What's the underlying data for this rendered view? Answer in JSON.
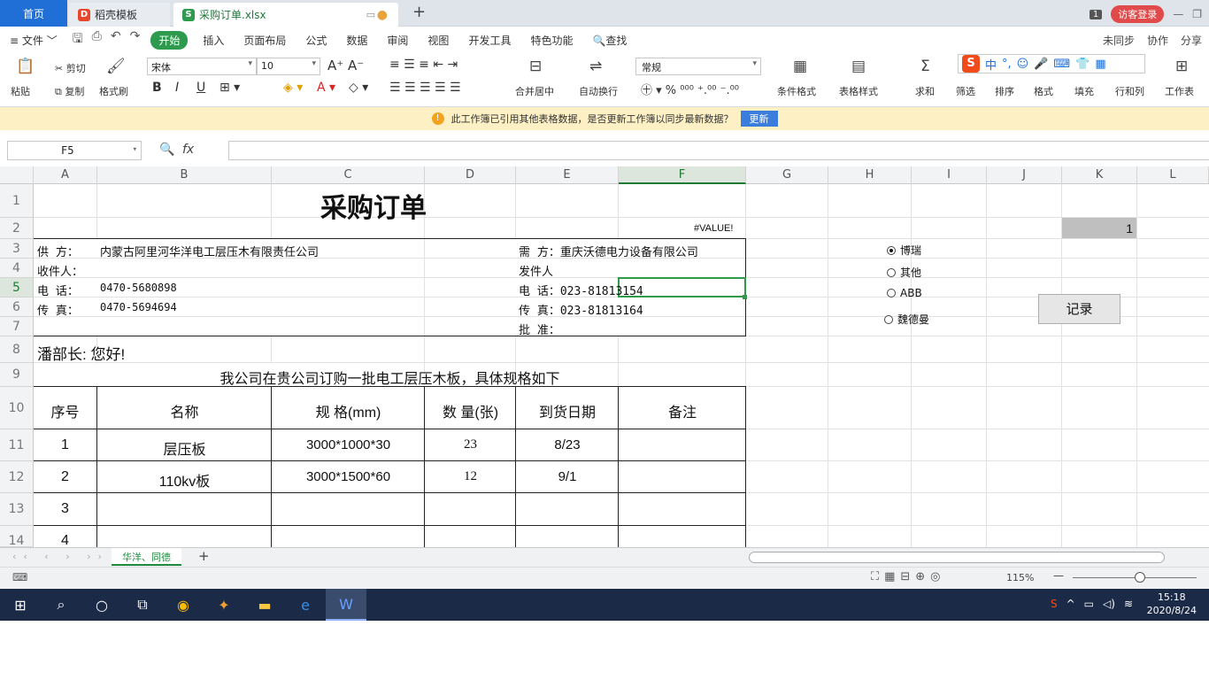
{
  "titlebar": {
    "home_tab": "首页",
    "tpl_tab": "稻壳模板",
    "file_tab": "采购订单.xlsx",
    "page_count": "1",
    "login": "访客登录"
  },
  "menu": {
    "file": "文件",
    "items": [
      "开始",
      "插入",
      "页面布局",
      "公式",
      "数据",
      "审阅",
      "视图",
      "开发工具",
      "特色功能"
    ],
    "search": "查找",
    "right": [
      "未同步",
      "协作",
      "分享"
    ]
  },
  "ribbon": {
    "paste": "粘贴",
    "cut": "剪切",
    "copy": "复制",
    "format_painter": "格式刷",
    "font": "宋体",
    "size": "10",
    "merge": "合并居中",
    "wrap": "自动换行",
    "number_format": "常规",
    "cond_format": "条件格式",
    "table_style": "表格样式",
    "sum": "求和",
    "filter": "筛选",
    "sort": "排序",
    "format": "格式",
    "fill": "填充",
    "row_col": "行和列",
    "worksheet": "工作表"
  },
  "notice": {
    "text": "此工作簿已引用其他表格数据，是否更新工作簿以同步最新数据？",
    "button": "更新"
  },
  "formula": {
    "name_box": "F5",
    "fx": "fx",
    "value": ""
  },
  "columns": [
    "A",
    "B",
    "C",
    "D",
    "E",
    "F",
    "G",
    "H",
    "I",
    "J",
    "K",
    "L"
  ],
  "rows": [
    "1",
    "2",
    "3",
    "4",
    "5",
    "6",
    "7",
    "8",
    "9",
    "10",
    "11",
    "12",
    "13",
    "14"
  ],
  "sheet": {
    "title": "采购订单",
    "error": "#VALUE!",
    "k2": "1",
    "supplier_label": "供  方：",
    "supplier": "内蒙古阿里河华洋电工层压木有限责任公司",
    "buyer": "需  方：重庆沃德电力设备有限公司",
    "receiver_label": "收件人：",
    "sender_label": "发件人",
    "phone_label": "电  话：",
    "phone": "0470-5680898",
    "buyer_phone": "电  话：023-81813154",
    "fax_label": "传  真：",
    "fax": "0470-5694694",
    "buyer_fax": "传  真：023-81813164",
    "approve": "批  准：",
    "greeting": "潘部长: 您好!",
    "intro": "我公司在贵公司订购一批电工层压木板，具体规格如下",
    "headers": [
      "序号",
      "名称",
      "规 格(mm)",
      "数 量(张)",
      "到货日期",
      "备注"
    ],
    "items": [
      {
        "no": "1",
        "name": "层压板",
        "spec": "3000*1000*30",
        "qty": "23",
        "date": "8/23"
      },
      {
        "no": "2",
        "name": "110kv板",
        "spec": "3000*1500*60",
        "qty": "12",
        "date": "9/1"
      },
      {
        "no": "3"
      },
      {
        "no": "4"
      }
    ]
  },
  "radios": [
    "博瑞",
    "其他",
    "ABB",
    "魏德曼"
  ],
  "record_button": "记录",
  "sheet_tab": "华洋、同德",
  "status": {
    "zoom": "115%"
  },
  "clock": {
    "time": "15:18",
    "date": "2020/8/24"
  }
}
